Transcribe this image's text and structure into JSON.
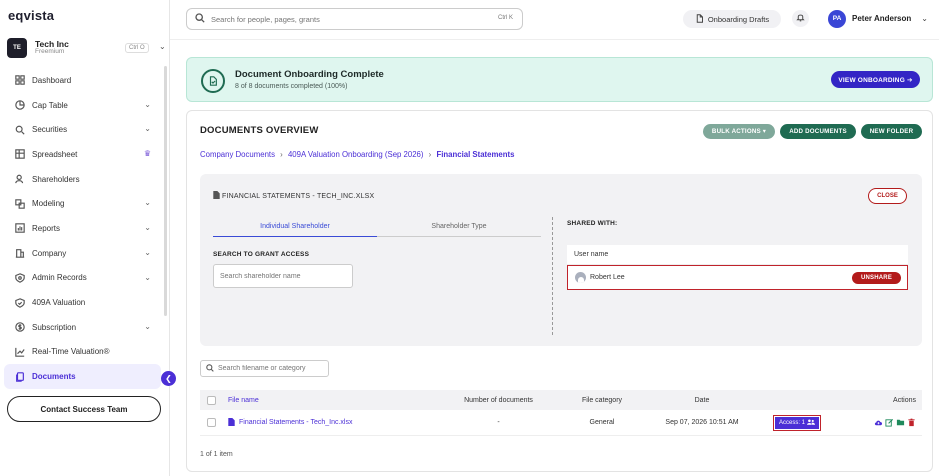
{
  "app": {
    "logo": "eqvista"
  },
  "company": {
    "initials": "TE",
    "name": "Tech Inc",
    "plan": "Freemium",
    "shortcut": "Ctrl O"
  },
  "sidebar": {
    "items": [
      {
        "label": "Dashboard",
        "icon": "dashboard-icon",
        "chevron": false
      },
      {
        "label": "Cap Table",
        "icon": "pie-chart-icon",
        "chevron": true
      },
      {
        "label": "Securities",
        "icon": "securities-icon",
        "chevron": true
      },
      {
        "label": "Spreadsheet",
        "icon": "table-icon",
        "chevron": false,
        "crown": true
      },
      {
        "label": "Shareholders",
        "icon": "users-icon",
        "chevron": false
      },
      {
        "label": "Modeling",
        "icon": "modeling-icon",
        "chevron": true
      },
      {
        "label": "Reports",
        "icon": "reports-icon",
        "chevron": true
      },
      {
        "label": "Company",
        "icon": "company-icon",
        "chevron": true
      },
      {
        "label": "Admin Records",
        "icon": "admin-icon",
        "chevron": true
      },
      {
        "label": "409A Valuation",
        "icon": "shield-icon",
        "chevron": false
      },
      {
        "label": "Subscription",
        "icon": "dollar-icon",
        "chevron": true
      },
      {
        "label": "Real-Time Valuation®",
        "icon": "trend-icon",
        "chevron": false
      },
      {
        "label": "Documents",
        "icon": "documents-icon",
        "chevron": false,
        "active": true
      }
    ],
    "contact_label": "Contact Success Team"
  },
  "topbar": {
    "search_placeholder": "Search for people, pages, grants",
    "search_shortcut": "Ctrl K",
    "drafts_label": "Onboarding Drafts",
    "user_initials": "PA",
    "user_name": "Peter Anderson"
  },
  "banner": {
    "title": "Document Onboarding Complete",
    "subtitle": "8 of 8 documents completed (100%)",
    "button": "VIEW ONBOARDING ➔"
  },
  "overview": {
    "title": "DOCUMENTS OVERVIEW",
    "bulk_actions": "BULK ACTIONS ▾",
    "add_documents": "ADD DOCUMENTS",
    "new_folder": "NEW FOLDER",
    "breadcrumb": [
      "Company Documents",
      "409A Valuation Onboarding (Sep 2026)",
      "Financial Statements"
    ],
    "breadcrumb_sep": "›"
  },
  "share_panel": {
    "file_name": "FINANCIAL STATEMENTS - TECH_INC.XLSX",
    "close_label": "CLOSE",
    "tabs": [
      "Individual Shareholder",
      "Shareholder Type"
    ],
    "grant_label": "SEARCH TO GRANT ACCESS",
    "search_placeholder": "Search shareholder name",
    "shared_with_label": "SHARED WITH:",
    "user_col": "User name",
    "shared_users": [
      {
        "name": "Robert Lee",
        "action": "UNSHARE"
      }
    ]
  },
  "files": {
    "search_placeholder": "Search filename or category",
    "columns": [
      "File name",
      "Number of documents",
      "File category",
      "Date",
      "Actions"
    ],
    "rows": [
      {
        "name": "Financial Statements - Tech_Inc.xlsx",
        "num_docs": "-",
        "category": "General",
        "date": "Sep 07, 2026 10:51 AM",
        "access": "Access: 1"
      }
    ],
    "pager": "1 of 1 item"
  },
  "colors": {
    "accent": "#4b2fd6",
    "green": "#1f6b52",
    "danger": "#b31b1b",
    "banner_bg": "#dff6ef"
  }
}
